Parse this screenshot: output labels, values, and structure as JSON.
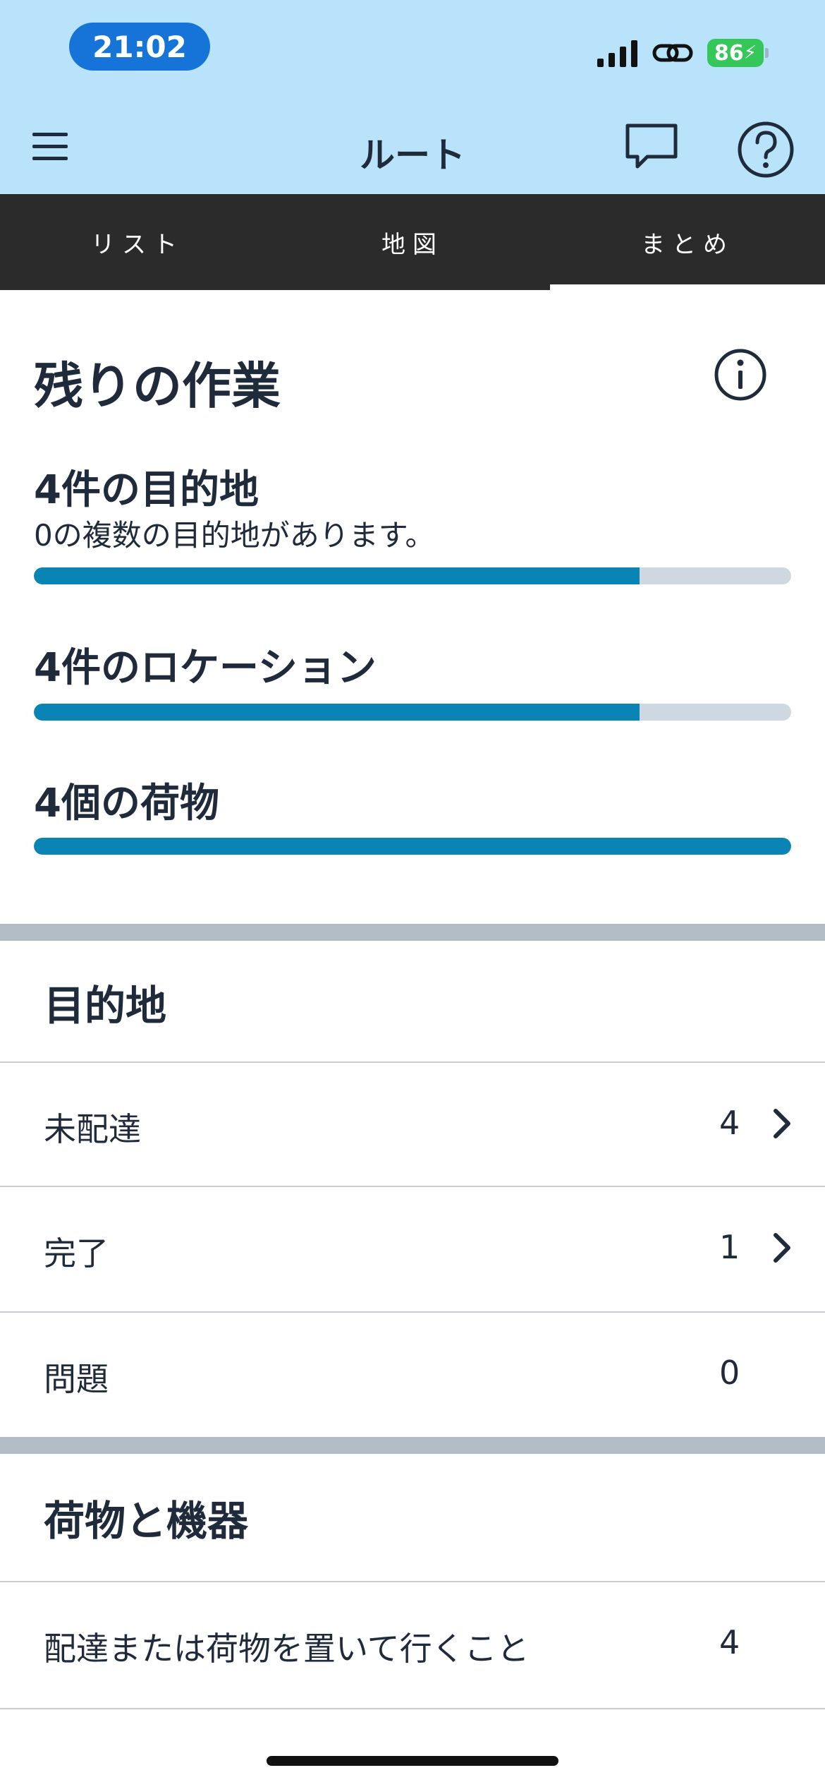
{
  "status_bar": {
    "time": "21:02",
    "battery": "86",
    "icons": [
      "signal-icon",
      "link-icon",
      "battery-icon"
    ]
  },
  "app_bar": {
    "title": "ルート",
    "icons": [
      "menu-icon",
      "chat-icon",
      "help-icon"
    ]
  },
  "tabs": [
    {
      "label": "リスト",
      "active": false
    },
    {
      "label": "地図",
      "active": false
    },
    {
      "label": "まとめ",
      "active": true
    }
  ],
  "remaining_work": {
    "title": "残りの作業",
    "destinations": {
      "label": "4件の目的地",
      "subtext": "0の複数の目的地があります。",
      "progress": 0.8
    },
    "locations": {
      "label": "4件のロケーション",
      "progress": 0.8
    },
    "packages": {
      "label": "4個の荷物",
      "progress": 1.0
    }
  },
  "destinations_section": {
    "title": "目的地",
    "rows": [
      {
        "label": "未配達",
        "count": "4",
        "has_chevron": true
      },
      {
        "label": "完了",
        "count": "1",
        "has_chevron": true
      },
      {
        "label": "問題",
        "count": "0",
        "has_chevron": false
      }
    ]
  },
  "packages_section": {
    "title": "荷物と機器",
    "rows": [
      {
        "label": "配達または荷物を置いて行くこと",
        "count": "4"
      }
    ]
  },
  "colors": {
    "header_bg": "#b8e3fb",
    "tabbar_bg": "#2b2b2b",
    "progress_fill": "#0a84b4",
    "progress_track": "#cfd8e1",
    "separator": "#b2bcc4",
    "battery": "#35c759",
    "time_pill": "#1673d8"
  }
}
